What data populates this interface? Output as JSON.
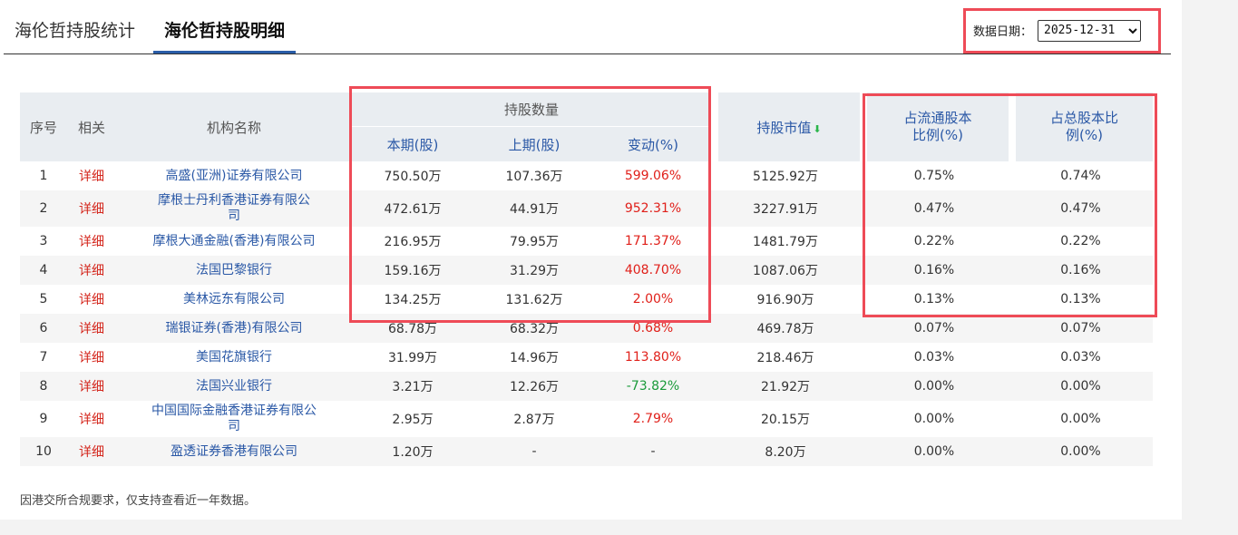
{
  "tabs": [
    "海伦哲持股统计",
    "海伦哲持股明细"
  ],
  "date_filter": {
    "label": "数据日期：",
    "selected": "2025-12-31"
  },
  "table": {
    "headers": {
      "seq": "序号",
      "related": "相关",
      "org_name": "机构名称",
      "hold_qty_group": "持股数量",
      "current": "本期(股)",
      "previous": "上期(股)",
      "change": "变动(%)",
      "market_value": "持股市值",
      "float_ratio": "占流通股本比例(%)",
      "total_ratio": "占总股本比例(%)"
    },
    "rows": [
      {
        "seq": "1",
        "link": "详细",
        "org": "高盛(亚洲)证券有限公司",
        "current": "750.50万",
        "previous": "107.36万",
        "change": "599.06%",
        "market_value": "5125.92万",
        "float_ratio": "0.75%",
        "total_ratio": "0.74%"
      },
      {
        "seq": "2",
        "link": "详细",
        "org": "摩根士丹利香港证券有限公司",
        "current": "472.61万",
        "previous": "44.91万",
        "change": "952.31%",
        "market_value": "3227.91万",
        "float_ratio": "0.47%",
        "total_ratio": "0.47%"
      },
      {
        "seq": "3",
        "link": "详细",
        "org": "摩根大通金融(香港)有限公司",
        "current": "216.95万",
        "previous": "79.95万",
        "change": "171.37%",
        "market_value": "1481.79万",
        "float_ratio": "0.22%",
        "total_ratio": "0.22%"
      },
      {
        "seq": "4",
        "link": "详细",
        "org": "法国巴黎银行",
        "current": "159.16万",
        "previous": "31.29万",
        "change": "408.70%",
        "market_value": "1087.06万",
        "float_ratio": "0.16%",
        "total_ratio": "0.16%"
      },
      {
        "seq": "5",
        "link": "详细",
        "org": "美林远东有限公司",
        "current": "134.25万",
        "previous": "131.62万",
        "change": "2.00%",
        "market_value": "916.90万",
        "float_ratio": "0.13%",
        "total_ratio": "0.13%"
      },
      {
        "seq": "6",
        "link": "详细",
        "org": "瑞银证券(香港)有限公司",
        "current": "68.78万",
        "previous": "68.32万",
        "change": "0.68%",
        "market_value": "469.78万",
        "float_ratio": "0.07%",
        "total_ratio": "0.07%"
      },
      {
        "seq": "7",
        "link": "详细",
        "org": "美国花旗银行",
        "current": "31.99万",
        "previous": "14.96万",
        "change": "113.80%",
        "market_value": "218.46万",
        "float_ratio": "0.03%",
        "total_ratio": "0.03%"
      },
      {
        "seq": "8",
        "link": "详细",
        "org": "法国兴业银行",
        "current": "3.21万",
        "previous": "12.26万",
        "change": "-73.82%",
        "market_value": "21.92万",
        "float_ratio": "0.00%",
        "total_ratio": "0.00%"
      },
      {
        "seq": "9",
        "link": "详细",
        "org": "中国国际金融香港证券有限公司",
        "current": "2.95万",
        "previous": "2.87万",
        "change": "2.79%",
        "market_value": "20.15万",
        "float_ratio": "0.00%",
        "total_ratio": "0.00%"
      },
      {
        "seq": "10",
        "link": "详细",
        "org": "盈透证券香港有限公司",
        "current": "1.20万",
        "previous": "-",
        "change": "-",
        "market_value": "8.20万",
        "float_ratio": "0.00%",
        "total_ratio": "0.00%"
      }
    ]
  },
  "footnote": "因港交所合规要求，仅支持查看近一年数据。",
  "icons": {
    "sort": "sort-down-arrow-icon"
  },
  "colors": {
    "link_blue": "#2a58a6",
    "up_red": "#e0201a",
    "down_green": "#1a9a3a",
    "highlight": "#ee4b57",
    "header_bg": "#e9edf1"
  }
}
